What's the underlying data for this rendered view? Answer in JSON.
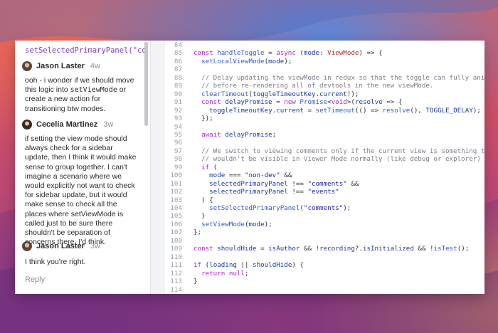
{
  "comments_panel": {
    "code_snippet": "setSelectedPrimaryPanel(\"co",
    "comments": [
      {
        "author": "Jason Laster",
        "time": "4w",
        "body_parts": [
          "ooh - i wonder if we should move this logic into ",
          "setViewMode",
          " or create a new action for transitioning btw modes."
        ]
      },
      {
        "author": "Cecelia Martinez",
        "time": "3w",
        "body": "if setting the view mode should always check for a sidebar update, then I think it would make sense to group together. I can't imagine a scenario where we would explicitly not want to check for sidebar update, but it would make sense to check all the places where setViewMode is called just to be sure there shouldn't be separation of concerns there, I'd think."
      },
      {
        "author": "Jason Laster",
        "time": "3w",
        "body": "I think you're right."
      }
    ],
    "reply_label": "Reply"
  },
  "editor": {
    "lines": [
      {
        "n": "84",
        "tokens": []
      },
      {
        "n": "85",
        "tokens": [
          [
            "k",
            "const "
          ],
          [
            "f",
            "handleToggle"
          ],
          [
            "p",
            " = "
          ],
          [
            "k",
            "async"
          ],
          [
            "p",
            " ("
          ],
          [
            "v",
            "mode"
          ],
          [
            "p",
            ": "
          ],
          [
            "t",
            "ViewMode"
          ],
          [
            "p",
            ") => {"
          ]
        ]
      },
      {
        "n": "86",
        "tokens": [
          [
            "p",
            "  "
          ],
          [
            "f",
            "setLocalViewMode"
          ],
          [
            "p",
            "("
          ],
          [
            "v",
            "mode"
          ],
          [
            "p",
            ");"
          ]
        ]
      },
      {
        "n": "87",
        "tokens": []
      },
      {
        "n": "88",
        "tokens": [
          [
            "c",
            "  // Delay updating the viewMode in redux so that the toggle can fully animate"
          ]
        ]
      },
      {
        "n": "89",
        "tokens": [
          [
            "c",
            "  // before re-rendering all of devtools in the new viewMode."
          ]
        ]
      },
      {
        "n": "90",
        "tokens": [
          [
            "p",
            "  "
          ],
          [
            "f",
            "clearTimeout"
          ],
          [
            "p",
            "("
          ],
          [
            "v",
            "toggleTimeoutKey"
          ],
          [
            "p",
            "."
          ],
          [
            "v",
            "current"
          ],
          [
            "p",
            "!);"
          ]
        ]
      },
      {
        "n": "91",
        "tokens": [
          [
            "p",
            "  "
          ],
          [
            "k",
            "const "
          ],
          [
            "v",
            "delayPromise"
          ],
          [
            "p",
            " = "
          ],
          [
            "k",
            "new "
          ],
          [
            "f",
            "Promise"
          ],
          [
            "p",
            "<"
          ],
          [
            "k",
            "void"
          ],
          [
            "p",
            ">("
          ],
          [
            "v",
            "resolve"
          ],
          [
            "p",
            " => {"
          ]
        ]
      },
      {
        "n": "92",
        "tokens": [
          [
            "p",
            "    "
          ],
          [
            "v",
            "toggleTimeoutKey"
          ],
          [
            "p",
            "."
          ],
          [
            "v",
            "current"
          ],
          [
            "p",
            " = "
          ],
          [
            "f",
            "setTimeout"
          ],
          [
            "p",
            "(() => "
          ],
          [
            "f",
            "resolve"
          ],
          [
            "p",
            "(), "
          ],
          [
            "v",
            "TOGGLE_DELAY"
          ],
          [
            "p",
            ");"
          ]
        ]
      },
      {
        "n": "93",
        "tokens": [
          [
            "p",
            "  });"
          ]
        ]
      },
      {
        "n": "94",
        "tokens": []
      },
      {
        "n": "95",
        "tokens": [
          [
            "p",
            "  "
          ],
          [
            "k",
            "await "
          ],
          [
            "v",
            "delayPromise"
          ],
          [
            "p",
            ";"
          ]
        ]
      },
      {
        "n": "96",
        "tokens": []
      },
      {
        "n": "97",
        "tokens": [
          [
            "c",
            "  // We switch to viewing comments only if the current view is something that"
          ]
        ]
      },
      {
        "n": "98",
        "tokens": [
          [
            "c",
            "  // wouldn't be visible in Viewer Mode normally (like debug or explorer)"
          ]
        ]
      },
      {
        "n": "99",
        "tokens": [
          [
            "p",
            "  "
          ],
          [
            "k",
            "if"
          ],
          [
            "p",
            " ("
          ]
        ]
      },
      {
        "n": "100",
        "tokens": [
          [
            "p",
            "    "
          ],
          [
            "v",
            "mode"
          ],
          [
            "p",
            " === "
          ],
          [
            "s",
            "\"non-dev\""
          ],
          [
            "p",
            " &&"
          ]
        ]
      },
      {
        "n": "101",
        "tokens": [
          [
            "p",
            "    "
          ],
          [
            "v",
            "selectedPrimaryPanel"
          ],
          [
            "p",
            " !== "
          ],
          [
            "s",
            "\"comments\""
          ],
          [
            "p",
            " &&"
          ]
        ]
      },
      {
        "n": "102",
        "tokens": [
          [
            "p",
            "    "
          ],
          [
            "v",
            "selectedPrimaryPanel"
          ],
          [
            "p",
            " !== "
          ],
          [
            "s",
            "\"events\""
          ]
        ]
      },
      {
        "n": "103",
        "tokens": [
          [
            "p",
            "  ) {"
          ]
        ]
      },
      {
        "n": "104",
        "tokens": [
          [
            "p",
            "    "
          ],
          [
            "f",
            "setSelectedPrimaryPanel"
          ],
          [
            "p",
            "("
          ],
          [
            "s",
            "\"comments\""
          ],
          [
            "p",
            ");"
          ]
        ]
      },
      {
        "n": "105",
        "tokens": [
          [
            "p",
            "  }"
          ]
        ]
      },
      {
        "n": "106",
        "tokens": [
          [
            "p",
            "  "
          ],
          [
            "f",
            "setViewMode"
          ],
          [
            "p",
            "("
          ],
          [
            "v",
            "mode"
          ],
          [
            "p",
            ");"
          ]
        ]
      },
      {
        "n": "107",
        "tokens": [
          [
            "p",
            "};"
          ]
        ]
      },
      {
        "n": "108",
        "tokens": []
      },
      {
        "n": "109",
        "tokens": [
          [
            "k",
            "const "
          ],
          [
            "v",
            "shouldHide"
          ],
          [
            "p",
            " = "
          ],
          [
            "v",
            "isAuthor"
          ],
          [
            "p",
            " && !"
          ],
          [
            "v",
            "recording"
          ],
          [
            "p",
            "?."
          ],
          [
            "v",
            "isInitialized"
          ],
          [
            "p",
            " && !"
          ],
          [
            "f",
            "isTest"
          ],
          [
            "p",
            "();"
          ]
        ]
      },
      {
        "n": "110",
        "tokens": []
      },
      {
        "n": "111",
        "tokens": [
          [
            "k",
            "if"
          ],
          [
            "p",
            " ("
          ],
          [
            "v",
            "loading"
          ],
          [
            "p",
            " || "
          ],
          [
            "v",
            "shouldHide"
          ],
          [
            "p",
            ") {"
          ]
        ]
      },
      {
        "n": "112",
        "tokens": [
          [
            "p",
            "  "
          ],
          [
            "k",
            "return "
          ],
          [
            "k",
            "null"
          ],
          [
            "p",
            ";"
          ]
        ]
      },
      {
        "n": "113",
        "tokens": [
          [
            "p",
            "}"
          ]
        ]
      },
      {
        "n": "114",
        "tokens": []
      }
    ]
  }
}
